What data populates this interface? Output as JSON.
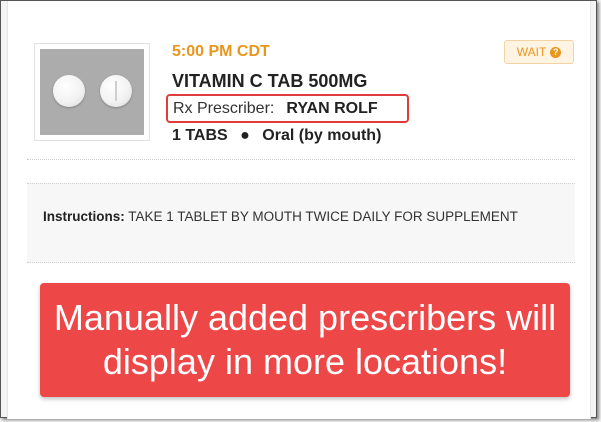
{
  "medication": {
    "time": "5:00 PM CDT",
    "status_button": {
      "label": "WAIT",
      "icon": "question-circle-icon",
      "icon_glyph": "?"
    },
    "name": "VITAMIN C TAB 500MG",
    "prescriber_label": "Rx Prescriber:",
    "prescriber_name": "RYAN ROLF",
    "quantity": "1 TABS",
    "separator": "●",
    "route": "Oral (by mouth)",
    "image_icon": "pill-image"
  },
  "instructions": {
    "label": "Instructions:",
    "text": "TAKE 1 TABLET BY MOUTH TWICE DAILY FOR SUPPLEMENT"
  },
  "banner": {
    "text": "Manually added prescribers will display in more locations!"
  },
  "colors": {
    "accent_orange": "#e8961c",
    "highlight_red": "#e03c3c",
    "banner_red": "#ee4747"
  }
}
